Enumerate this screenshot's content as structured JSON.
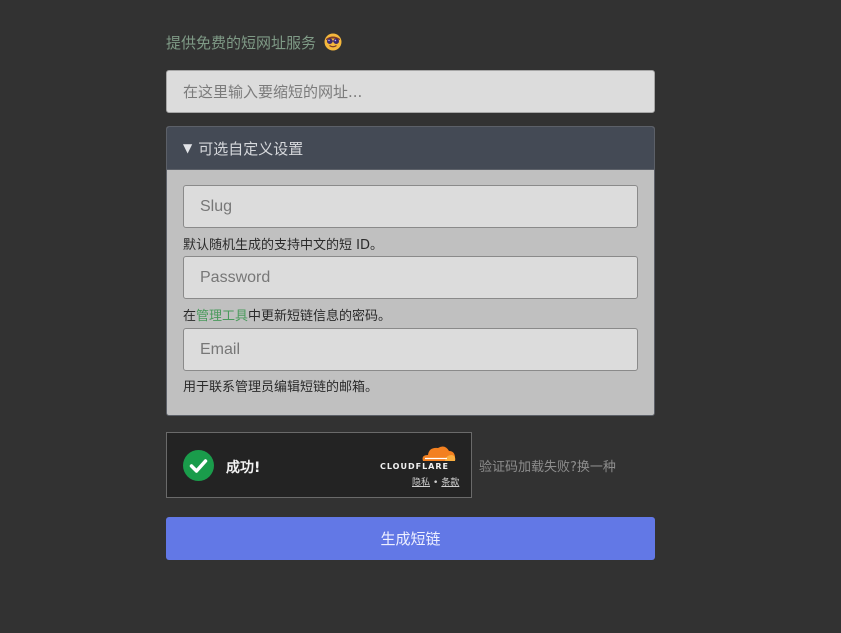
{
  "tagline": "提供免费的短网址服务",
  "tagline_icon": "emoji-cool-face-icon",
  "url_input": {
    "placeholder": "在这里输入要缩短的网址...",
    "value": ""
  },
  "options": {
    "summary_marker": "▼",
    "summary_label": "可选自定义设置",
    "slug": {
      "placeholder": "Slug",
      "value": ""
    },
    "slug_hint": "默认随机生成的支持中文的短 ID。",
    "password": {
      "placeholder": "Password",
      "value": ""
    },
    "password_hint_before": "在",
    "password_hint_link": "管理工具",
    "password_hint_after": "中更新短链信息的密码。",
    "email": {
      "placeholder": "Email",
      "value": ""
    },
    "email_hint": "用于联系管理员编辑短链的邮箱。"
  },
  "captcha": {
    "status": "成功!",
    "brand": "CLOUDFLARE",
    "privacy_link": "隐私",
    "separator": "•",
    "terms_link": "条款",
    "fail_text": "验证码加载失败?换一种"
  },
  "submit_label": "生成短链",
  "colors": {
    "background": "#323232",
    "accent": "#6278e6",
    "success": "#1a9c4b",
    "link": "#4a9a5c",
    "cloudflare": "#f38020"
  }
}
